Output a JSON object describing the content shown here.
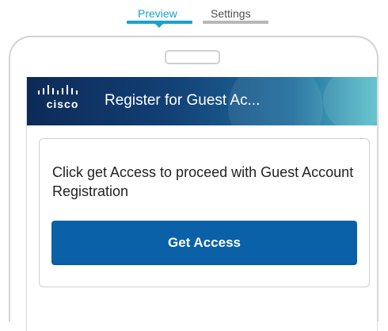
{
  "tabs": [
    {
      "label": "Preview",
      "active": true
    },
    {
      "label": "Settings",
      "active": false
    }
  ],
  "portal": {
    "logo_text": "cisco",
    "title": "Register for Guest Ac...",
    "instruction": "Click get Access to proceed with Guest Account Registration",
    "button_label": "Get Access"
  },
  "colors": {
    "preview_accent": "#1aa2c8",
    "settings_underline": "#b8b8b8",
    "header_dark": "#0d2a57",
    "header_light": "#57c0c9",
    "button": "#0b61a7",
    "frame": "#d3d3d3"
  },
  "icons": {
    "caret": "caret-down-icon",
    "logo": "cisco-logo-icon"
  }
}
